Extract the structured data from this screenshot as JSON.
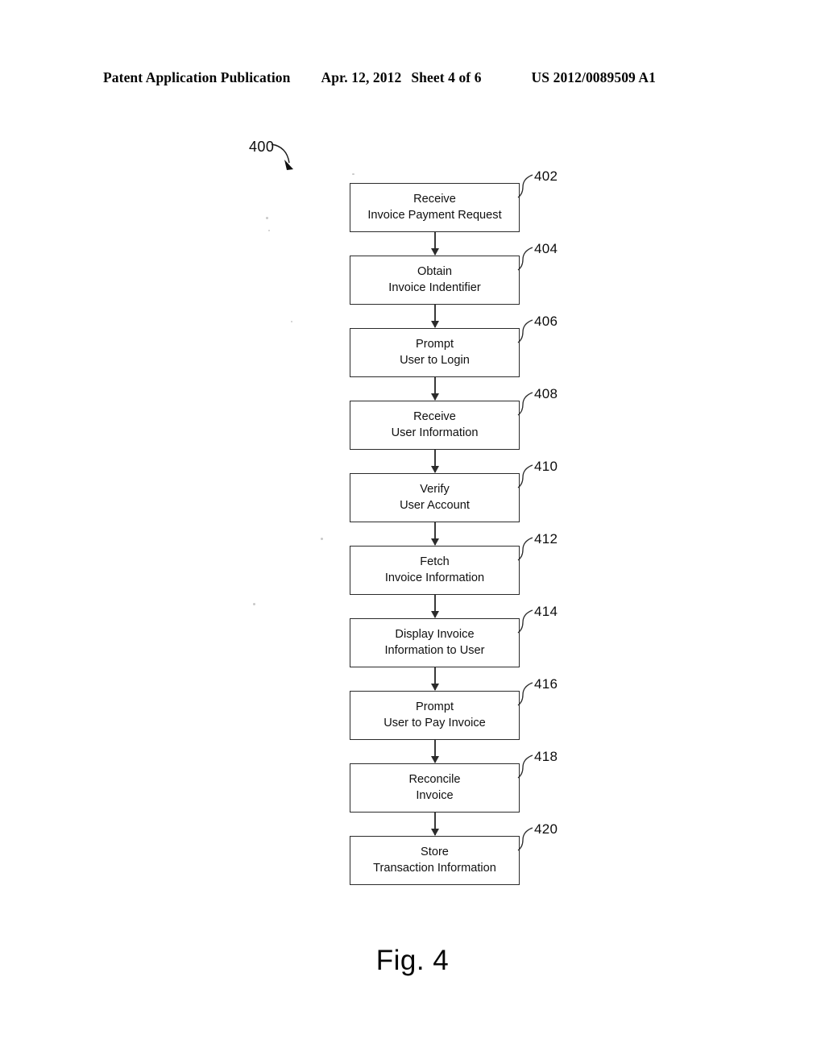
{
  "header": {
    "publication": "Patent Application Publication",
    "date": "Apr. 12, 2012",
    "sheet": "Sheet 4 of 6",
    "document_number": "US 2012/0089509 A1"
  },
  "figure": {
    "caption": "Fig. 4",
    "diagram_reference": "400",
    "steps": [
      {
        "ref": "402",
        "line1": "Receive",
        "line2": "Invoice Payment Request"
      },
      {
        "ref": "404",
        "line1": "Obtain",
        "line2": "Invoice Indentifier"
      },
      {
        "ref": "406",
        "line1": "Prompt",
        "line2": "User to Login"
      },
      {
        "ref": "408",
        "line1": "Receive",
        "line2": "User Information"
      },
      {
        "ref": "410",
        "line1": "Verify",
        "line2": "User Account"
      },
      {
        "ref": "412",
        "line1": "Fetch",
        "line2": "Invoice Information"
      },
      {
        "ref": "414",
        "line1": "Display Invoice",
        "line2": "Information to User"
      },
      {
        "ref": "416",
        "line1": "Prompt",
        "line2": "User to Pay Invoice"
      },
      {
        "ref": "418",
        "line1": "Reconcile",
        "line2": "Invoice"
      },
      {
        "ref": "420",
        "line1": "Store",
        "line2": "Transaction Information"
      }
    ]
  },
  "colors": {
    "ink": "#101010",
    "line": "#2b2b2b",
    "paper": "#ffffff"
  }
}
